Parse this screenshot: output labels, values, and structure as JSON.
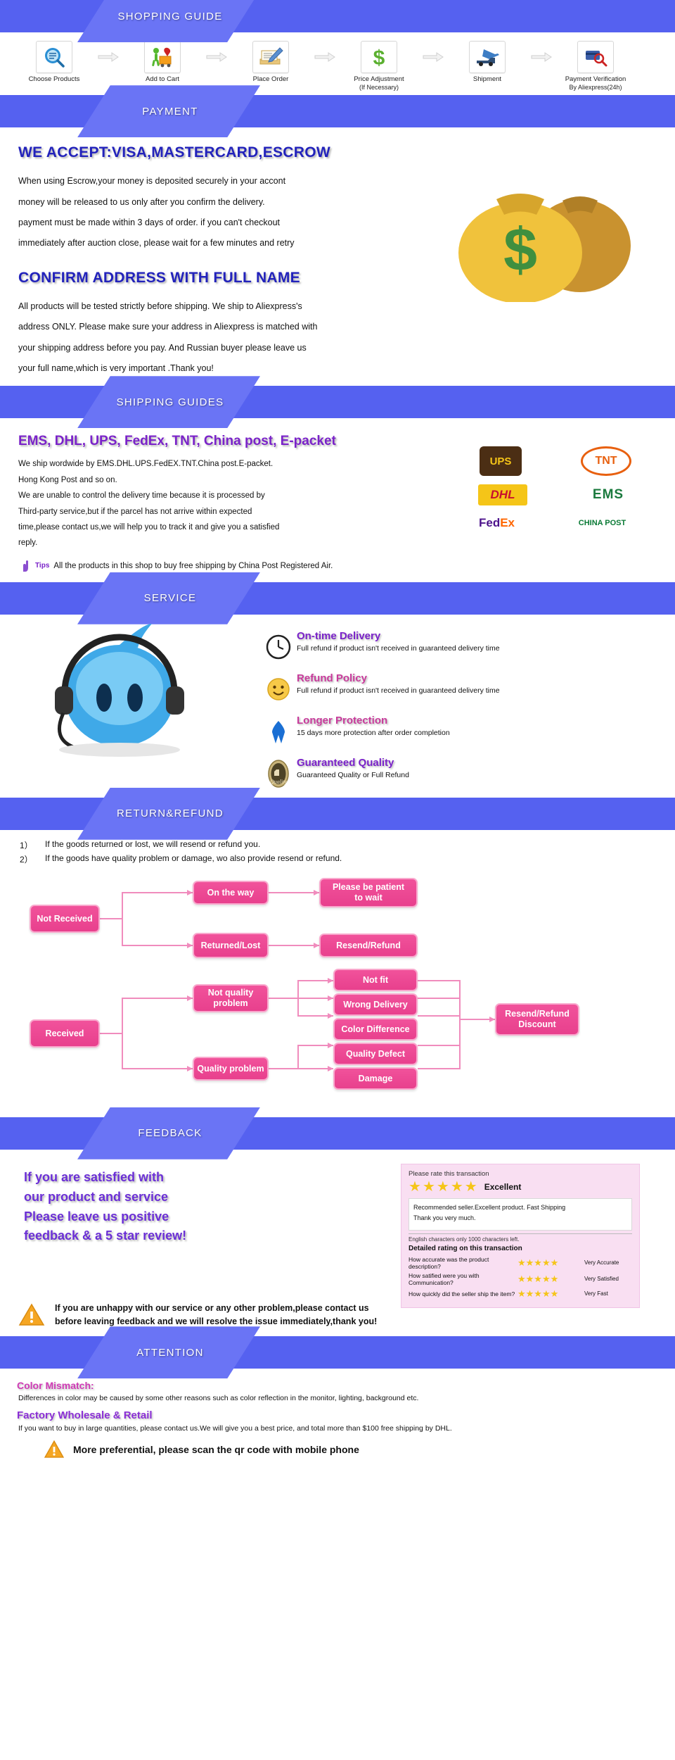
{
  "sections": {
    "shopping_guide": "SHOPPING GUIDE",
    "payment": "PAYMENT",
    "shipping": "SHIPPING GUIDES",
    "service": "SERVICE",
    "return_refund": "RETURN&REFUND",
    "feedback": "FEEDBACK",
    "attention": "ATTENTION"
  },
  "steps": [
    {
      "label": "Choose Products",
      "sub": "",
      "icon": "magnifier-document-icon"
    },
    {
      "label": "Add to Cart",
      "sub": "",
      "icon": "shopping-cart-icon"
    },
    {
      "label": "Place Order",
      "sub": "",
      "icon": "pen-envelope-icon"
    },
    {
      "label": "Price Adjustment",
      "sub": "(If Necessary)",
      "icon": "dollar-sign-icon"
    },
    {
      "label": "Shipment",
      "sub": "",
      "icon": "airplane-truck-icon"
    },
    {
      "label": "Payment Verification",
      "sub": "By Aliexpress(24h)",
      "icon": "magnifier-card-icon"
    }
  ],
  "payment": {
    "heading1": "WE ACCEPT:VISA,MASTERCARD,ESCROW",
    "lines1": [
      "When using Escrow,your money is deposited securely in your accont",
      "money will be released to us only after you confirm the delivery.",
      "payment must be made within 3 days of order. if you can't checkout",
      "immediately after auction close, please wait for a few minutes and retry"
    ],
    "heading2": "CONFIRM ADDRESS WITH FULL NAME",
    "lines2": [
      "All products will be tested strictly before shipping. We ship to Aliexpress's",
      "address ONLY. Please make sure your address in Aliexpress is matched with",
      "your shipping address before you pay. And Russian buyer please leave us",
      "your full name,which is very important .Thank you!"
    ]
  },
  "shipping": {
    "title": "EMS, DHL, UPS, FedEx, TNT, China post, E-packet",
    "lines": [
      "We ship wordwide by EMS.DHL.UPS.FedEX.TNT.China post.E-packet.",
      "Hong Kong Post and so on.",
      "We are unable to control the delivery time because it is processed by",
      "Third-party service,but if the parcel has not arrive within expected",
      "time,please contact us,we will help you to track it and give you a satisfied",
      "reply."
    ],
    "couriers": [
      "UPS",
      "TNT",
      "DHL",
      "EMS",
      "FedEx",
      "CHINA POST"
    ],
    "tips_badge": "Tips",
    "tips_text": "All the products in this shop to buy free shipping by China Post Registered Air."
  },
  "service": {
    "items": [
      {
        "title": "On-time Delivery",
        "sub": "Full refund if product isn't received in guaranteed delivery time",
        "icon": "clock-icon",
        "color": "#7a22c9"
      },
      {
        "title": "Refund Policy",
        "sub": "Full refund if product isn't received in guaranteed delivery time",
        "icon": "smiley-icon",
        "color": "#c83a9b"
      },
      {
        "title": "Longer Protection",
        "sub": "15 days more protection after order completion",
        "icon": "blue-ribbon-icon",
        "color": "#c83a9b"
      },
      {
        "title": "Guaranteed Quality",
        "sub": "Guaranteed Quality or Full Refund",
        "icon": "quality-seal-icon",
        "color": "#7a22c9"
      }
    ]
  },
  "return_refund": {
    "line1_num": "1）",
    "line1": "If the goods returned or lost, we will resend or refund you.",
    "line2_num": "2）",
    "line2": "If the goods have quality problem or damage, wo also provide resend or refund.",
    "nodes": {
      "not_received": "Not Received",
      "on_the_way": "On the way",
      "returned_lost": "Returned/Lost",
      "please_wait": "Please be patient\nto wait",
      "resend_refund": "Resend/Refund",
      "received": "Received",
      "not_quality": "Not quality\nproblem",
      "quality_problem": "Quality problem",
      "not_fit": "Not fit",
      "wrong_delivery": "Wrong Delivery",
      "color_difference": "Color Difference",
      "quality_defect": "Quality Defect",
      "damage": "Damage",
      "resend_refund_discount": "Resend/Refund\nDiscount"
    }
  },
  "feedback": {
    "left_lines": [
      "If you are satisfied with",
      "our product and service",
      "Please leave us positive",
      "feedback & a 5 star review!"
    ],
    "box": {
      "prompt": "Please rate this transaction",
      "stars": 5,
      "excellent": "Excellent",
      "comment_line1": "Recommended seller.Excellent product. Fast Shipping",
      "comment_line2": "Thank you very much.",
      "char_note": "English characters only 1000 characters left.",
      "detail_title": "Detailed rating on this transaction",
      "rows": [
        {
          "question": "How accurate was the product description?",
          "stars": 5,
          "value": "Very Accurate"
        },
        {
          "question": "How satified were you with Communication?",
          "stars": 5,
          "value": "Very Satisfied"
        },
        {
          "question": "How quickly did the seller ship the item?",
          "stars": 5,
          "value": "Very Fast"
        }
      ]
    },
    "warning": "If you are unhappy with our service or any other problem,please contact us\nbefore leaving feedback and we will resolve the issue immediately,thank you!"
  },
  "attention": {
    "h1": "Color Mismatch:",
    "p1": "Differences in color may be caused by some other reasons such  as color reflection in the monitor, lighting, background etc.",
    "h2": "Factory Wholesale & Retail",
    "p2": "If you want to buy in large quantities, please contact us.We will give you a best price, and total more than $100 free shipping by DHL.",
    "final": "More preferential, please scan the qr code with mobile phone"
  },
  "colors": {
    "banner": "#5561f0",
    "tag": "#6a74f5",
    "pink_node": "#ee4a94",
    "purple_text": "#7a22c9",
    "star": "#f5c518"
  }
}
